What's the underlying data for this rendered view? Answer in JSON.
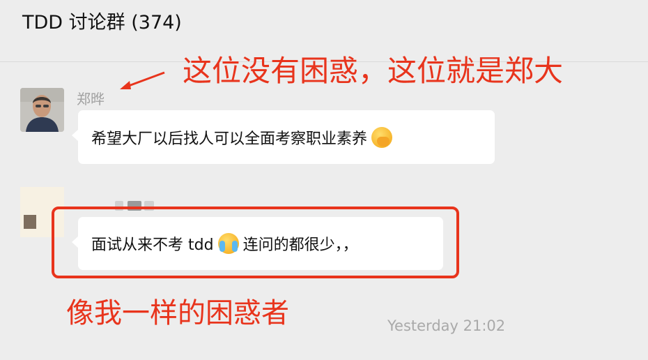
{
  "header": {
    "title": "TDD 讨论群 (374)"
  },
  "annotations": {
    "top": "这位没有困惑，这位就是郑大",
    "bottom": "像我一样的困惑者"
  },
  "messages": [
    {
      "sender": "郑晔",
      "text": "希望大厂以后找人可以全面考察职业素养",
      "emoji": "hand-over-mouth-emoji"
    },
    {
      "sender": "",
      "text_before": "面试从来不考 tdd",
      "emoji": "loudly-crying-emoji",
      "text_after": " 连问的都很少，，"
    }
  ],
  "timestamp": "Yesterday 21:02",
  "colors": {
    "annotation": "#e8341c",
    "background": "#ededed",
    "bubble": "#ffffff"
  }
}
